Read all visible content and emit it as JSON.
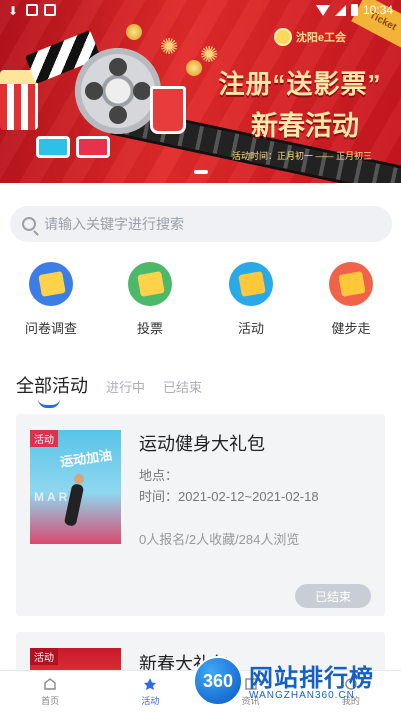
{
  "status_bar": {
    "time": "10:34"
  },
  "banner": {
    "logo_text": "沈阳e工会",
    "headline": "注册“送影票”",
    "subline": "新春活动",
    "timeline": "活动时间：正月初一 —— 正月初三",
    "ticket_text": "Ticket"
  },
  "search": {
    "placeholder": "请输入关键字进行搜索"
  },
  "quick_entries": [
    {
      "label": "问卷调查",
      "icon": "survey-icon",
      "color": "#3d7de6",
      "tile": "#ffd24a"
    },
    {
      "label": "投票",
      "icon": "vote-icon",
      "color": "#4cb86a",
      "tile": "#ffd24a"
    },
    {
      "label": "活动",
      "icon": "activity-icon",
      "color": "#29a9e8",
      "tile": "#ffc83a"
    },
    {
      "label": "健步走",
      "icon": "walk-icon",
      "color": "#f0624a",
      "tile": "#ffc83a"
    }
  ],
  "tabs": [
    {
      "label": "全部活动",
      "active": true
    },
    {
      "label": "进行中",
      "active": false
    },
    {
      "label": "已结束",
      "active": false
    }
  ],
  "activities": [
    {
      "tag": "活动",
      "title": "运动健身大礼包",
      "place": "地点：",
      "time": "时间：2021-02-12~2021-02-18",
      "stats": "0人报名/2人收藏/284人浏览",
      "status": "已结束",
      "poster_art": "运动加油",
      "poster_word": "MARK"
    },
    {
      "tag": "活动",
      "title": "新春大礼包"
    }
  ],
  "bottom_nav": [
    {
      "label": "首页",
      "icon": "home-icon"
    },
    {
      "label": "活动",
      "icon": "star-icon",
      "active": true
    },
    {
      "label": "资讯",
      "icon": "news-icon"
    },
    {
      "label": "我的",
      "icon": "profile-icon"
    }
  ],
  "watermark": {
    "badge": "360",
    "text": "网站排行榜",
    "url": "WANGZHAN360.CN"
  },
  "colors": {
    "accent": "#2d6cdf",
    "banner_red": "#e22a2a",
    "card_bg": "#f3f4f6"
  }
}
